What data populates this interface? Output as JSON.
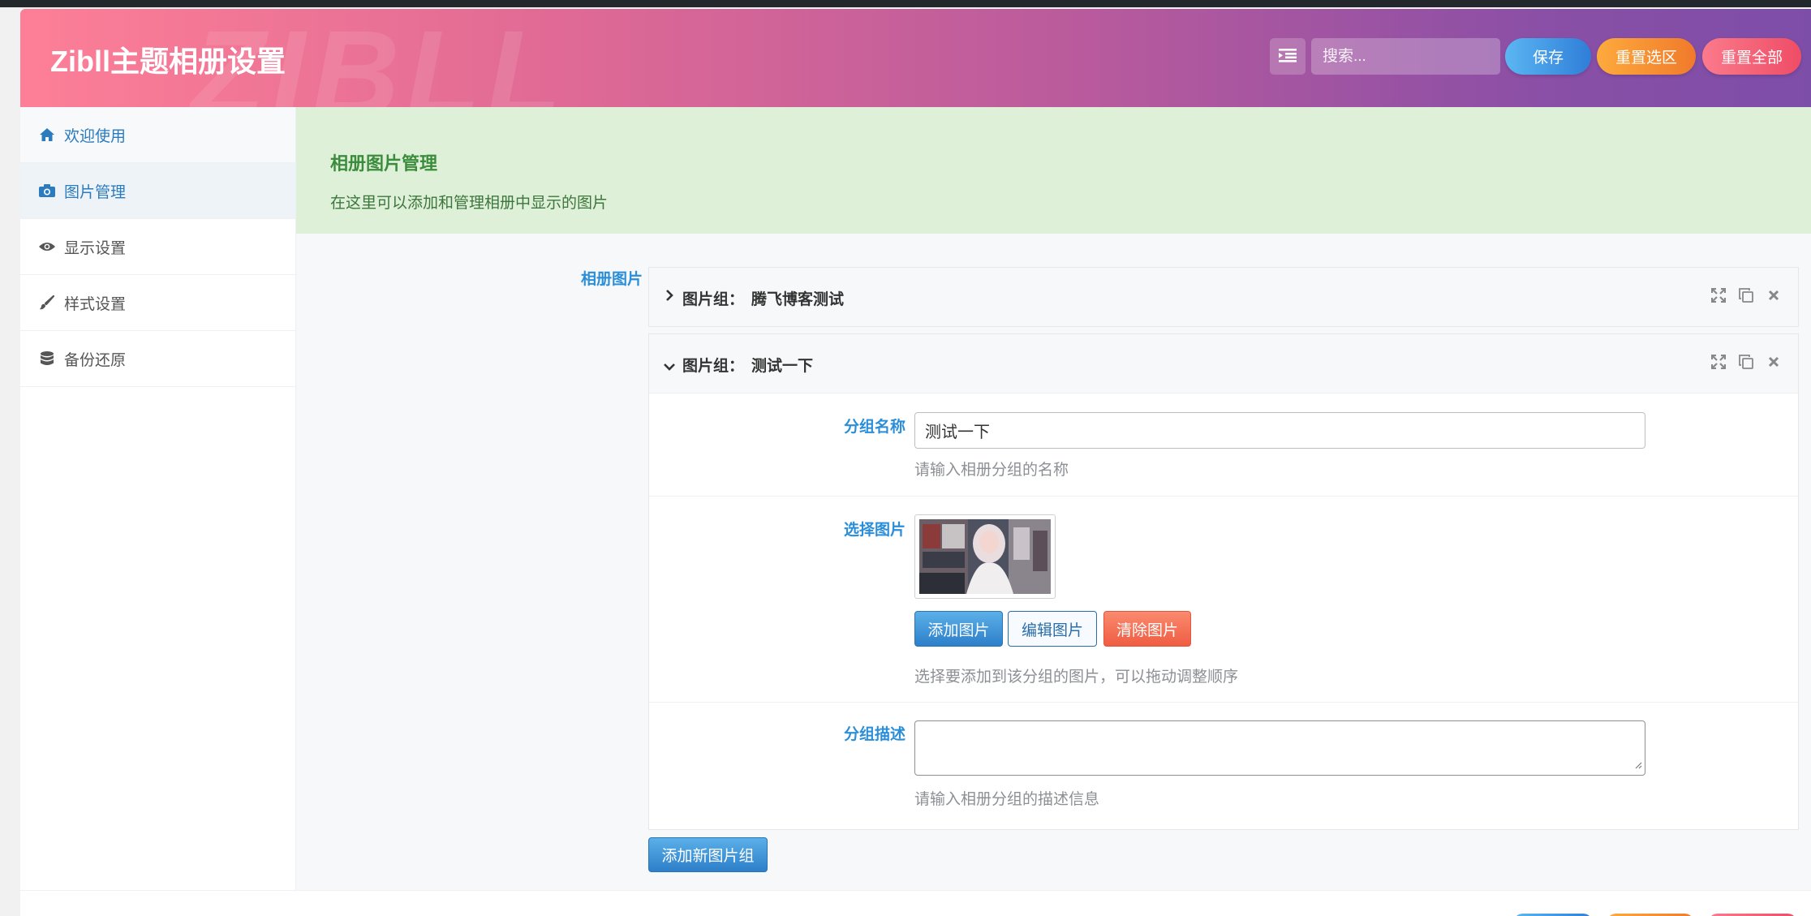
{
  "header": {
    "brand": "Zibll主题相册设置",
    "watermark": "ZIBLL",
    "search_placeholder": "搜索...",
    "save_label": "保存",
    "reset_section_label": "重置选区",
    "reset_all_label": "重置全部"
  },
  "sidebar": {
    "items": [
      {
        "label": "欢迎使用",
        "icon": "home-icon"
      },
      {
        "label": "图片管理",
        "icon": "camera-icon"
      },
      {
        "label": "显示设置",
        "icon": "eye-icon"
      },
      {
        "label": "样式设置",
        "icon": "paint-brush-icon"
      },
      {
        "label": "备份还原",
        "icon": "database-icon"
      }
    ]
  },
  "notice": {
    "title": "相册图片管理",
    "description": "在这里可以添加和管理相册中显示的图片"
  },
  "gallery": {
    "field_label": "相册图片",
    "groups": [
      {
        "prefix": "图片组：",
        "name": "腾飞博客测试",
        "expanded": false
      },
      {
        "prefix": "图片组：",
        "name": "测试一下",
        "expanded": true
      }
    ],
    "form": {
      "name_label": "分组名称",
      "name_value": "测试一下",
      "name_help": "请输入相册分组的名称",
      "image_label": "选择图片",
      "add_image": "添加图片",
      "edit_image": "编辑图片",
      "clear_image": "清除图片",
      "image_help": "选择要添加到该分组的图片，可以拖动调整顺序",
      "desc_label": "分组描述",
      "desc_value": "",
      "desc_help": "请输入相册分组的描述信息"
    },
    "add_group_label": "添加新图片组"
  },
  "colors": {
    "accent_blue": "#2b8ed8",
    "notice_bg": "#dff0d8",
    "notice_title": "#3c8c3e",
    "header_gradient_start": "#fd7f97",
    "header_gradient_end": "#7d4ea8"
  }
}
